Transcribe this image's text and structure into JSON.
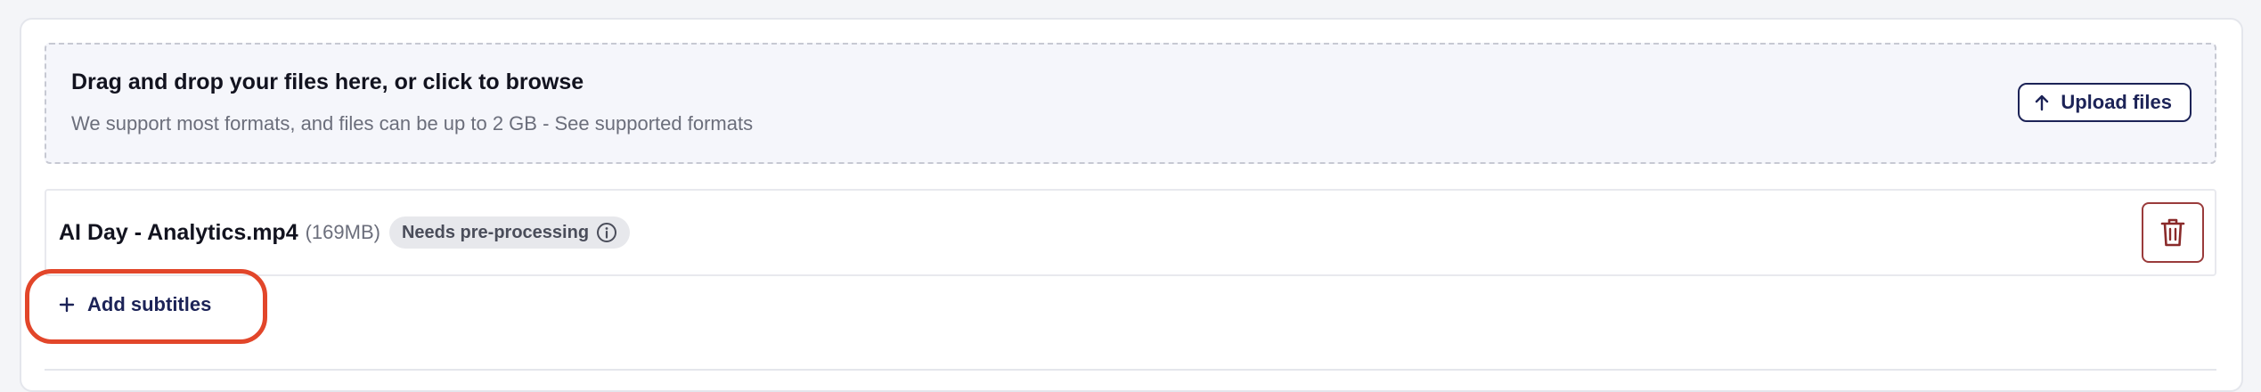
{
  "dropzone": {
    "title": "Drag and drop your files here, or click to browse",
    "subtitle": "We support most formats, and files can be up to 2 GB - See supported formats",
    "upload_button": {
      "label": "Upload files",
      "icon": "arrow-up-icon"
    }
  },
  "files": [
    {
      "name": "AI Day - Analytics.mp4",
      "size": "(169MB)",
      "status_badge": {
        "label": "Needs pre-processing",
        "icon": "info-icon"
      },
      "delete_icon": "trash-icon"
    }
  ],
  "add_subtitles": {
    "label": "Add subtitles",
    "icon": "plus-icon"
  },
  "colors": {
    "accent_navy": "#1c2357",
    "danger": "#9a3b3b",
    "highlight": "#e2462a",
    "dropzone_bg": "#f5f6fb",
    "badge_bg": "#e7e8ec"
  }
}
